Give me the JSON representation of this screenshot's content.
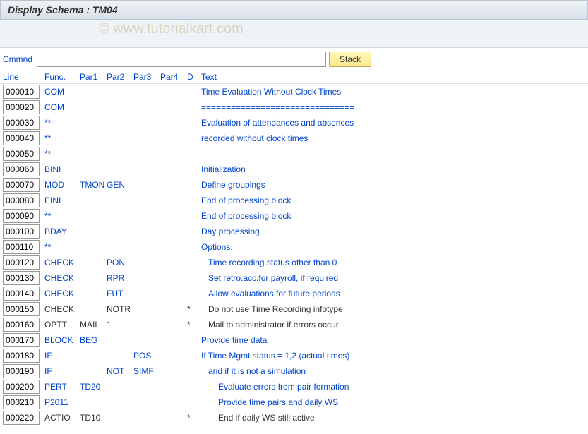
{
  "titleBar": "Display Schema : TM04",
  "watermark": "© www.tutorialkart.com",
  "commandBar": {
    "label": "Cmmnd",
    "value": "",
    "stackLabel": "Stack"
  },
  "headers": {
    "line": "Line",
    "func": "Func.",
    "par1": "Par1",
    "par2": "Par2",
    "par3": "Par3",
    "par4": "Par4",
    "d": "D",
    "text": "Text"
  },
  "rows": [
    {
      "line": "000010",
      "func": "COM",
      "par1": "",
      "par2": "",
      "par3": "",
      "par4": "",
      "d": "",
      "text": "Time Evaluation Without Clock Times",
      "indent": 0,
      "inactive": false
    },
    {
      "line": "000020",
      "func": "COM",
      "par1": "",
      "par2": "",
      "par3": "",
      "par4": "",
      "d": "",
      "text": "===============================",
      "indent": 0,
      "inactive": false
    },
    {
      "line": "000030",
      "func": "**",
      "par1": "",
      "par2": "",
      "par3": "",
      "par4": "",
      "d": "",
      "text": "Evaluation of attendances and absences",
      "indent": 0,
      "inactive": false
    },
    {
      "line": "000040",
      "func": "**",
      "par1": "",
      "par2": "",
      "par3": "",
      "par4": "",
      "d": "",
      "text": "recorded without clock times",
      "indent": 0,
      "inactive": false
    },
    {
      "line": "000050",
      "func": "**",
      "par1": "",
      "par2": "",
      "par3": "",
      "par4": "",
      "d": "",
      "text": "",
      "indent": 0,
      "inactive": false
    },
    {
      "line": "000060",
      "func": "BINI",
      "par1": "",
      "par2": "",
      "par3": "",
      "par4": "",
      "d": "",
      "text": "Initialization",
      "indent": 0,
      "inactive": false
    },
    {
      "line": "000070",
      "func": "MOD",
      "par1": "TMON",
      "par2": "GEN",
      "par3": "",
      "par4": "",
      "d": "",
      "text": "Define groupings",
      "indent": 0,
      "inactive": false
    },
    {
      "line": "000080",
      "func": "EINI",
      "par1": "",
      "par2": "",
      "par3": "",
      "par4": "",
      "d": "",
      "text": "End of processing block",
      "indent": 0,
      "inactive": false
    },
    {
      "line": "000090",
      "func": "**",
      "par1": "",
      "par2": "",
      "par3": "",
      "par4": "",
      "d": "",
      "text": "End of processing block",
      "indent": 0,
      "inactive": false
    },
    {
      "line": "000100",
      "func": "BDAY",
      "par1": "",
      "par2": "",
      "par3": "",
      "par4": "",
      "d": "",
      "text": "Day processing",
      "indent": 0,
      "inactive": false
    },
    {
      "line": "000110",
      "func": "**",
      "par1": "",
      "par2": "",
      "par3": "",
      "par4": "",
      "d": "",
      "text": "Options:",
      "indent": 0,
      "inactive": false
    },
    {
      "line": "000120",
      "func": "CHECK",
      "par1": "",
      "par2": "PON",
      "par3": "",
      "par4": "",
      "d": "",
      "text": "Time recording status other than 0",
      "indent": 1,
      "inactive": false
    },
    {
      "line": "000130",
      "func": "CHECK",
      "par1": "",
      "par2": "RPR",
      "par3": "",
      "par4": "",
      "d": "",
      "text": "Set retro.acc.for payroll, if required",
      "indent": 1,
      "inactive": false
    },
    {
      "line": "000140",
      "func": "CHECK",
      "par1": "",
      "par2": "FUT",
      "par3": "",
      "par4": "",
      "d": "",
      "text": "Allow evaluations for future periods",
      "indent": 1,
      "inactive": false
    },
    {
      "line": "000150",
      "func": "CHECK",
      "par1": "",
      "par2": "NOTR",
      "par3": "",
      "par4": "",
      "d": "*",
      "text": "Do not use Time Recording infotype",
      "indent": 1,
      "inactive": true
    },
    {
      "line": "000160",
      "func": "OPTT",
      "par1": "MAIL",
      "par2": "1",
      "par3": "",
      "par4": "",
      "d": "*",
      "text": "Mail to administrator if errors occur",
      "indent": 1,
      "inactive": true
    },
    {
      "line": "000170",
      "func": "BLOCK",
      "par1": "BEG",
      "par2": "",
      "par3": "",
      "par4": "",
      "d": "",
      "text": "Provide time data",
      "indent": 0,
      "inactive": false
    },
    {
      "line": "000180",
      "func": "IF",
      "par1": "",
      "par2": "",
      "par3": "POS",
      "par4": "",
      "d": "",
      "text": "If Time Mgmt status = 1,2 (actual times)",
      "indent": 0,
      "inactive": false
    },
    {
      "line": "000190",
      "func": "IF",
      "par1": "",
      "par2": "NOT",
      "par3": "SIMF",
      "par4": "",
      "d": "",
      "text": "and if it is not a simulation",
      "indent": 1,
      "inactive": false
    },
    {
      "line": "000200",
      "func": "PERT",
      "par1": "TD20",
      "par2": "",
      "par3": "",
      "par4": "",
      "d": "",
      "text": "Evaluate errors from pair formation",
      "indent": 2,
      "inactive": false
    },
    {
      "line": "000210",
      "func": "P2011",
      "par1": "",
      "par2": "",
      "par3": "",
      "par4": "",
      "d": "",
      "text": "Provide time pairs and daily WS",
      "indent": 2,
      "inactive": false
    },
    {
      "line": "000220",
      "func": "ACTIO",
      "par1": "TD10",
      "par2": "",
      "par3": "",
      "par4": "",
      "d": "*",
      "text": "End if daily WS still active",
      "indent": 2,
      "inactive": true
    }
  ]
}
